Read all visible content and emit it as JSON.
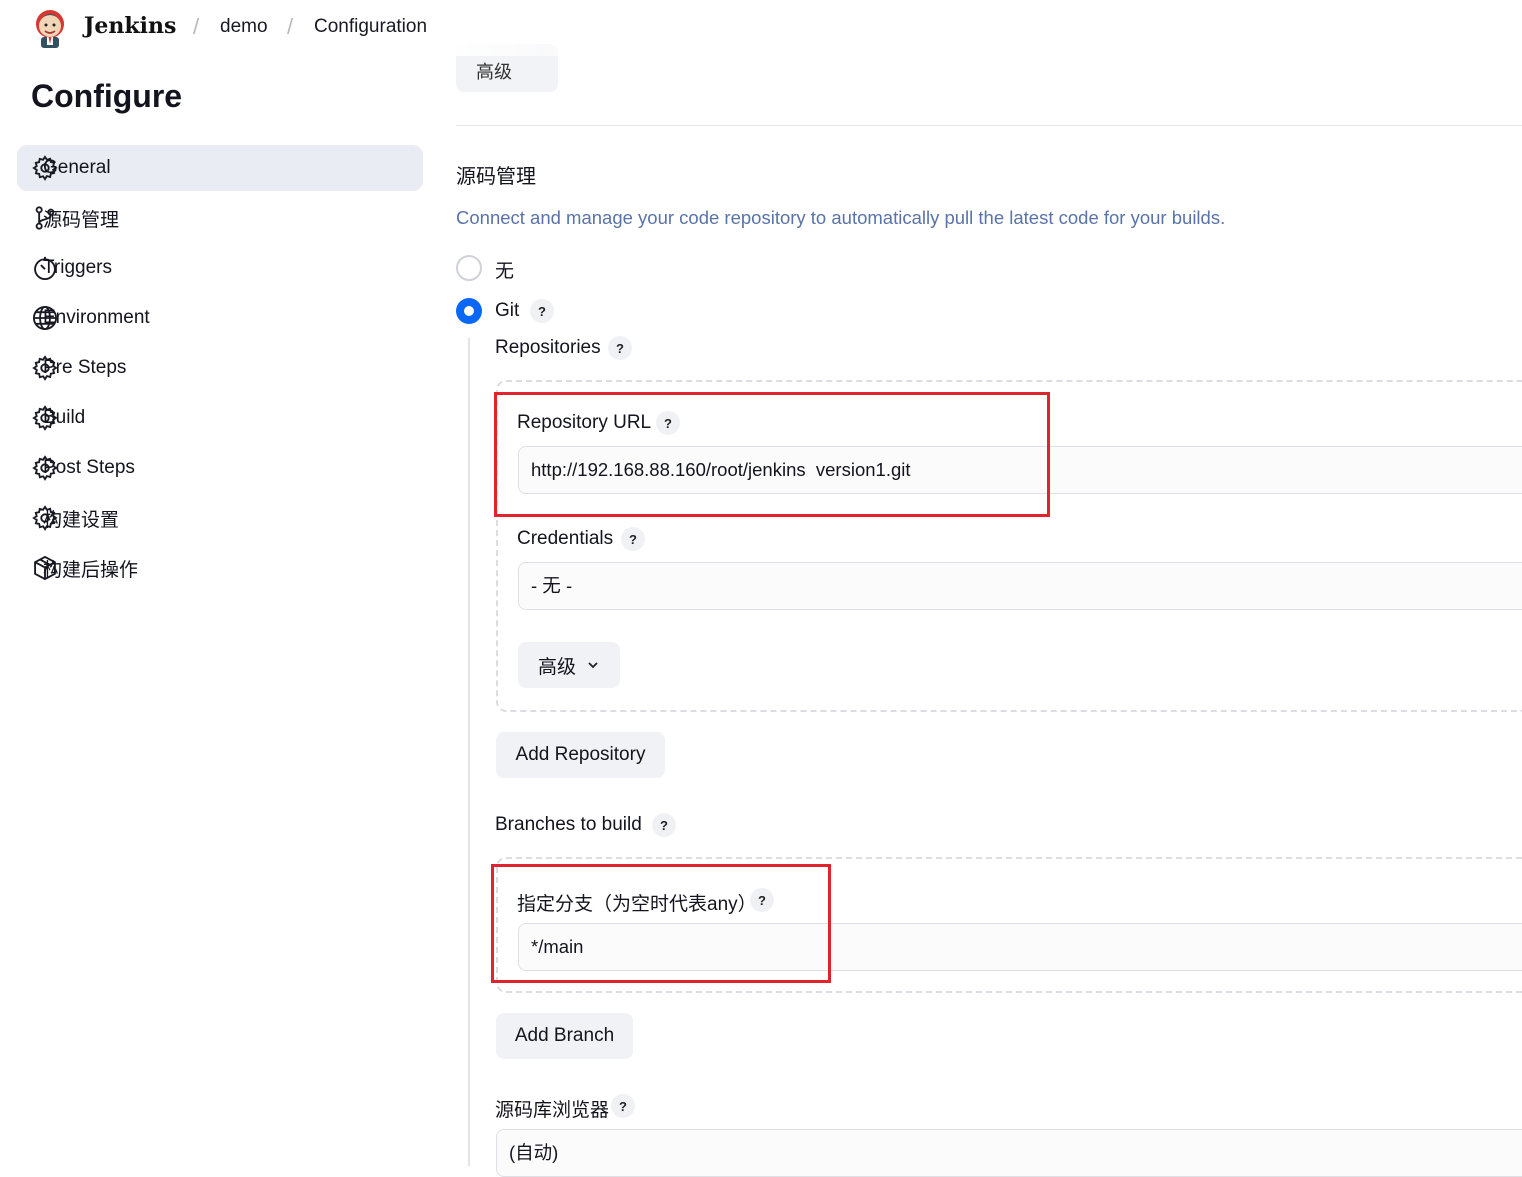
{
  "header": {
    "brand": "Jenkins",
    "breadcrumbs": [
      "demo",
      "Configuration"
    ]
  },
  "page_title": "Configure",
  "sidebar": {
    "items": [
      {
        "label": "General",
        "icon": "gear-icon",
        "active": true
      },
      {
        "label": "源码管理",
        "icon": "git-branch-icon"
      },
      {
        "label": "Triggers",
        "icon": "timer-icon"
      },
      {
        "label": "Environment",
        "icon": "globe-icon"
      },
      {
        "label": "Pre Steps",
        "icon": "gear-icon"
      },
      {
        "label": "Build",
        "icon": "gear-icon"
      },
      {
        "label": "Post Steps",
        "icon": "gear-icon"
      },
      {
        "label": "构建设置",
        "icon": "gear-icon"
      },
      {
        "label": "构建后操作",
        "icon": "package-icon"
      }
    ]
  },
  "main": {
    "advanced_top_label": "高级",
    "section_title": "源码管理",
    "section_description": "Connect and manage your code repository to automatically pull the latest code for your builds.",
    "scm_options": [
      {
        "label": "无",
        "selected": false
      },
      {
        "label": "Git",
        "selected": true
      }
    ],
    "help_glyph": "?",
    "repositories_label": "Repositories",
    "repository_url_label": "Repository URL",
    "repository_url_value": "http://192.168.88.160/root/jenkins  version1.git",
    "credentials_label": "Credentials",
    "credentials_value": "- 无 -",
    "advanced_label": "高级",
    "add_repository_label": "Add Repository",
    "branches_label": "Branches to build",
    "branch_specifier_label": "指定分支（为空时代表any）",
    "branch_value": "*/main",
    "add_branch_label": "Add Branch",
    "repo_browser_label": "源码库浏览器",
    "repo_browser_value": "(自动)"
  },
  "colors": {
    "accent_blue": "#0b67f5",
    "description_text": "#5a73a8",
    "highlight_red": "#e0232d",
    "sidebar_active_bg": "#e9ecf3"
  }
}
